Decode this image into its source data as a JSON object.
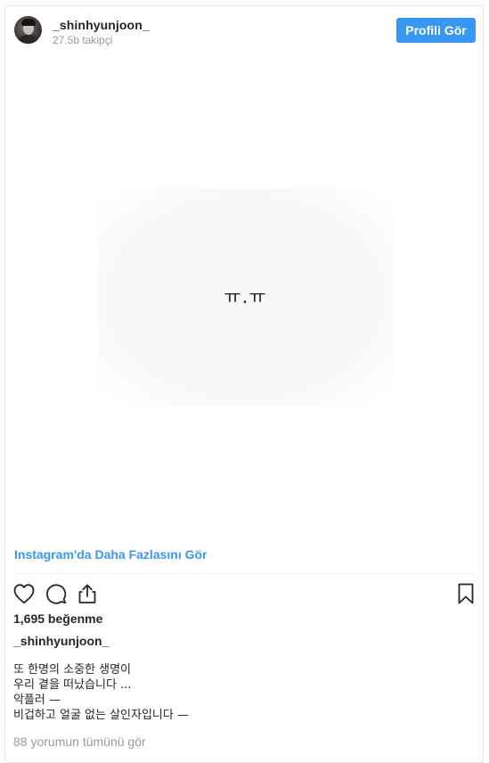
{
  "header": {
    "username": "_shinhyunjoon_",
    "followers": "27.5b takipçi",
    "follow_button": "Profili Gör"
  },
  "media": {
    "text": "ㅠ.ㅠ"
  },
  "view_more": "Instagram'da Daha Fazlasını Gör",
  "actions": {
    "like": "heart-icon",
    "comment": "comment-icon",
    "share": "share-icon",
    "save": "bookmark-icon"
  },
  "likes": "1,695 beğenme",
  "author": "_shinhyunjoon_",
  "caption": [
    "또 한명의 소중한 생명이",
    "우리 곁을 떠났습니다 ...",
    "악플러 —",
    "비겁하고 얼굴 없는 살인자입니다 —"
  ],
  "comments_link": "88 yorumun tümünü gör",
  "colors": {
    "accent": "#3897f0",
    "text": "#262626",
    "muted": "#999999",
    "border": "#e6e6e6"
  }
}
